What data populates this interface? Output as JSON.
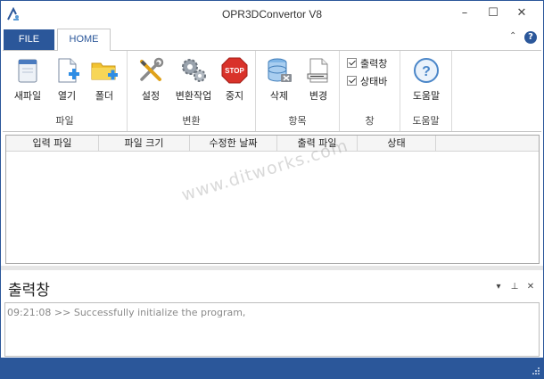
{
  "window": {
    "title": "OPR3DConvertor V8",
    "minimize_glyph": "–",
    "maximize_glyph": "☐",
    "close_glyph": "✕"
  },
  "tabs": {
    "file": "FILE",
    "home": "HOME",
    "collapse_glyph": "⌃",
    "help_glyph": "?"
  },
  "ribbon": {
    "groups": [
      {
        "label": "파일",
        "buttons": [
          {
            "label": "새파일",
            "icon": "new-file-icon"
          },
          {
            "label": "열기",
            "icon": "open-file-icon"
          },
          {
            "label": "폴더",
            "icon": "folder-icon"
          }
        ]
      },
      {
        "label": "변환",
        "buttons": [
          {
            "label": "설정",
            "icon": "settings-tools-icon"
          },
          {
            "label": "변환작업",
            "icon": "gears-icon"
          },
          {
            "label": "중지",
            "icon": "stop-icon",
            "icon_text": "STOP"
          }
        ]
      },
      {
        "label": "항목",
        "buttons": [
          {
            "label": "삭제",
            "icon": "delete-database-icon"
          },
          {
            "label": "변경",
            "icon": "edit-document-icon"
          }
        ]
      },
      {
        "label": "창",
        "checkboxes": [
          {
            "label": "출력창",
            "checked": true
          },
          {
            "label": "상태바",
            "checked": true
          }
        ]
      },
      {
        "label": "도움말",
        "buttons": [
          {
            "label": "도움말",
            "icon": "help-icon",
            "icon_text": "?"
          }
        ]
      }
    ]
  },
  "list": {
    "columns": [
      "입력 파일",
      "파일 크기",
      "수정한 날짜",
      "출력 파일",
      "상태"
    ],
    "rows": []
  },
  "watermark": "www.ditworks.com",
  "output": {
    "title": "출력창",
    "pin_glyph": "⊥",
    "dropdown_glyph": "▾",
    "close_glyph": "✕",
    "log": [
      {
        "time": "09:21:08",
        "separator": ">>",
        "message": "Successfully initialize the program,"
      }
    ]
  },
  "colors": {
    "accent": "#2b579a",
    "stop": "#d9322a"
  }
}
